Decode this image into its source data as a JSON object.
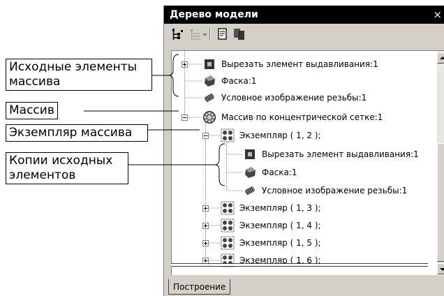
{
  "window": {
    "title": "Дерево модели",
    "close_glyph": "×",
    "tab_label": "Построение"
  },
  "toolbar": {
    "buttons": [
      {
        "icon": "tree-structure-icon"
      },
      {
        "icon": "tree-filter-icon"
      },
      {
        "icon": "dropdown-arrow-icon"
      },
      {
        "icon": "document-icon"
      },
      {
        "icon": "copy-pages-icon"
      }
    ]
  },
  "tree": {
    "items": [
      {
        "label": "Вырезать элемент выдавливания:1",
        "icon": "extrude-cut-icon",
        "expander": "plus"
      },
      {
        "label": "Фаска:1",
        "icon": "chamfer-icon",
        "expander": "none"
      },
      {
        "label": "Условное изображение резьбы:1",
        "icon": "thread-icon",
        "expander": "none"
      },
      {
        "label": "Массив по концентрической сетке:1",
        "icon": "concentric-array-icon",
        "expander": "minus"
      },
      {
        "label": "Экземпляр ( 1, 2 );",
        "icon": "instance-icon",
        "expander": "minus"
      },
      {
        "label": "Вырезать элемент выдавливания:1",
        "icon": "extrude-cut-icon",
        "expander": "none"
      },
      {
        "label": "Фаска:1",
        "icon": "chamfer-icon",
        "expander": "none"
      },
      {
        "label": "Условное изображение резьбы:1",
        "icon": "thread-icon",
        "expander": "none"
      },
      {
        "label": "Экземпляр ( 1, 3 );",
        "icon": "instance-icon",
        "expander": "plus"
      },
      {
        "label": "Экземпляр ( 1, 4 );",
        "icon": "instance-icon",
        "expander": "plus"
      },
      {
        "label": "Экземпляр ( 1, 5 );",
        "icon": "instance-icon",
        "expander": "plus"
      },
      {
        "label": "Экземпляр ( 1, 6 );",
        "icon": "instance-icon",
        "expander": "plus"
      }
    ]
  },
  "callouts": {
    "source_elements": {
      "line1": "Исходные элементы",
      "line2": "массива"
    },
    "array": {
      "line1": "Массив"
    },
    "array_instance": {
      "line1": "Экземпляр массива"
    },
    "copies": {
      "line1": "Копии исходных",
      "line2": "элементов"
    }
  },
  "colors": {
    "titlebar": "#000000",
    "panel": "#d4d0c8",
    "tree_background": "#ffffff"
  }
}
